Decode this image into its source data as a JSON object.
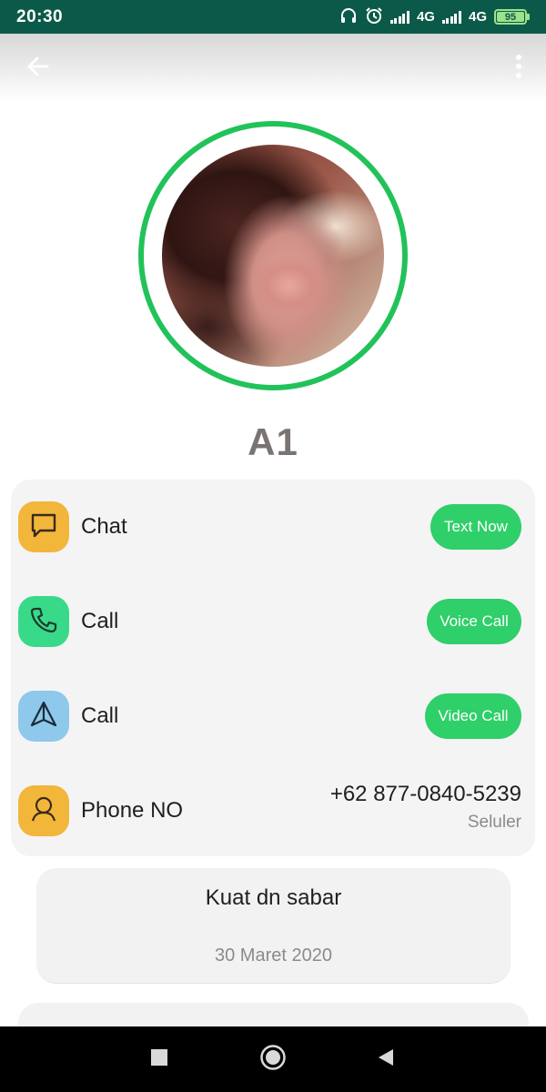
{
  "status_bar": {
    "time": "20:30",
    "network_1": "4G",
    "network_2": "4G",
    "battery": "95",
    "icons": [
      "headphones-icon",
      "alarm-icon",
      "signal-icon",
      "battery-icon"
    ]
  },
  "header": {
    "back_icon": "arrow-left-icon",
    "menu_icon": "more-vertical-icon"
  },
  "contact": {
    "name": "A1",
    "avatar_ring_color": "#22c25a"
  },
  "actions": [
    {
      "icon": "chat-bubble-icon",
      "icon_bg": "#f2b63b",
      "label": "Chat",
      "button": "Text Now"
    },
    {
      "icon": "phone-icon",
      "icon_bg": "#39d98a",
      "label": "Call",
      "button": "Voice Call"
    },
    {
      "icon": "paper-plane-icon",
      "icon_bg": "#8ec8ea",
      "label": "Call",
      "button": "Video Call"
    },
    {
      "icon": "person-icon",
      "icon_bg": "#f2b63b",
      "label": "Phone NO",
      "phone": "+62 877-0840-5239",
      "phone_type": "Seluler"
    }
  ],
  "status_card": {
    "text": "Kuat dn sabar",
    "date": "30 Maret 2020"
  },
  "colors": {
    "accent_green": "#2fcf69",
    "status_bar_bg": "#0b5a49"
  },
  "nav": {
    "recents_icon": "square-icon",
    "home_icon": "circle-icon",
    "back_icon": "triangle-back-icon"
  }
}
